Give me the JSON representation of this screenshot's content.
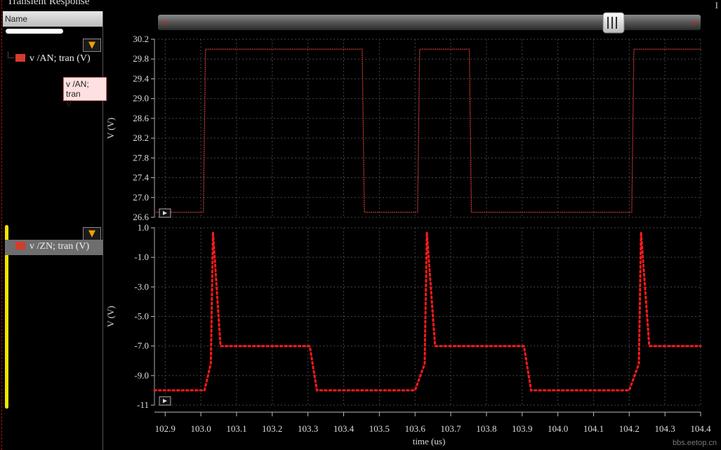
{
  "window": {
    "title": "Transient Response",
    "right_mark": "I"
  },
  "panel": {
    "header": "Name",
    "items": [
      {
        "label": "v /AN; tran (V)",
        "color": "#d43c2c"
      },
      {
        "label": "v /ZN; tran (V)",
        "color": "#d43c2c"
      }
    ],
    "tooltip": {
      "line1": "v /AN; tran",
      "line2": "V"
    }
  },
  "icons": {
    "filter": "filter-funnel-icon",
    "play": "play-icon"
  },
  "watermark": "bbs.eetop.cn",
  "chart_data": [
    {
      "type": "line",
      "series": [
        {
          "name": "v /AN; tran (V)",
          "color": "#c83a2e",
          "x": [
            102.87,
            103.007,
            103.013,
            103.452,
            103.458,
            103.607,
            103.613,
            103.752,
            103.758,
            104.207,
            104.213,
            104.4
          ],
          "y": [
            26.7,
            26.7,
            30.0,
            30.0,
            26.7,
            26.7,
            30.0,
            30.0,
            26.7,
            26.7,
            30.0,
            30.0
          ]
        }
      ],
      "xlabel": "",
      "ylabel": "V (V)",
      "ylim": [
        26.6,
        30.2
      ],
      "yticks": [
        "26.6",
        "27.0",
        "27.4",
        "27.8",
        "28.2",
        "28.6",
        "29.0",
        "29.4",
        "29.8",
        "30.2"
      ],
      "grid": true
    },
    {
      "type": "line",
      "series": [
        {
          "name": "v /ZN; tran (V)",
          "color": "#ff1a1a",
          "x": [
            102.87,
            103.01,
            103.028,
            103.034,
            103.055,
            103.305,
            103.325,
            103.6,
            103.627,
            103.633,
            103.656,
            103.905,
            103.925,
            104.2,
            104.227,
            104.233,
            104.256,
            104.4
          ],
          "y": [
            -10.0,
            -10.0,
            -8.2,
            0.7,
            -7.0,
            -7.0,
            -10.0,
            -10.0,
            -8.2,
            0.7,
            -7.0,
            -7.0,
            -10.0,
            -10.0,
            -8.2,
            0.7,
            -7.0,
            -7.0
          ]
        }
      ],
      "xlabel": "time (us)",
      "ylabel": "V (V)",
      "ylim": [
        -11.0,
        1.0
      ],
      "yticks": [
        "-11",
        "-9.0",
        "-7.0",
        "-5.0",
        "-3.0",
        "-1.0",
        "1.0"
      ],
      "xlim": [
        102.87,
        104.4
      ],
      "xticks": [
        "102.9",
        "103.0",
        "103.1",
        "103.2",
        "103.3",
        "103.4",
        "103.5",
        "103.6",
        "103.7",
        "103.8",
        "103.9",
        "104.0",
        "104.1",
        "104.2",
        "104.3",
        "104.4"
      ],
      "grid": true
    }
  ]
}
